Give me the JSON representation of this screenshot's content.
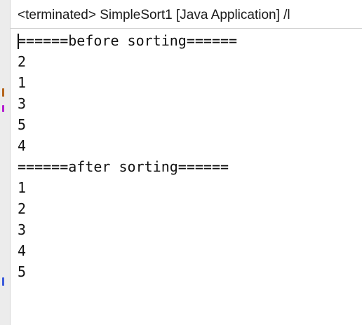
{
  "console": {
    "title": "<terminated> SimpleSort1 [Java Application] /l",
    "lines": [
      "======before sorting======",
      "2",
      "1",
      "3",
      "5",
      "4",
      "======after sorting======",
      "1",
      "2",
      "3",
      "4",
      "5"
    ]
  },
  "colors": {
    "background": "#ffffff",
    "text": "#111111",
    "gutter": "#ececec"
  }
}
